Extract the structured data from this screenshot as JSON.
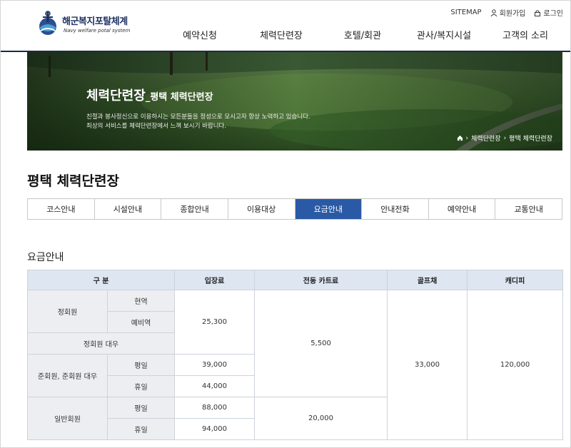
{
  "header": {
    "logo_title": "해군복지포탈체계",
    "logo_sub": "Navy welfare potal system",
    "util": {
      "sitemap": "SITEMAP",
      "join": "회원가입",
      "login": "로그인"
    },
    "gnb": [
      "예약신청",
      "체력단련장",
      "호텔/회관",
      "관사/복지시설",
      "고객의 소리"
    ]
  },
  "hero": {
    "title": "체력단련장",
    "subtitle": "_평택 체력단련장",
    "desc_line1": "친절과 봉사정신으로 이용하시는 모든분들을 정성으로 모시고자 항상 노력하고 있습니다.",
    "desc_line2": "최상의 서비스를 체력단련장에서 느껴 보시기 바랍니다.",
    "breadcrumb": [
      "체력단련장",
      "평택 체력단련장"
    ]
  },
  "page_title": "평택 체력단련장",
  "tabs": [
    {
      "label": "코스안내",
      "active": false
    },
    {
      "label": "시설안내",
      "active": false
    },
    {
      "label": "종합안내",
      "active": false
    },
    {
      "label": "이용대상",
      "active": false
    },
    {
      "label": "요금안내",
      "active": true
    },
    {
      "label": "안내전화",
      "active": false
    },
    {
      "label": "예약안내",
      "active": false
    },
    {
      "label": "교통안내",
      "active": false
    }
  ],
  "section_title": "요금안내",
  "table": {
    "headers": [
      "구 분",
      "입장료",
      "전동 카트료",
      "골프채",
      "캐디피"
    ],
    "groups": {
      "regular": "정회원",
      "regular_proxy": "정회원 대우",
      "associate": "준회원, 준회원 대우",
      "general": "일반회원"
    },
    "sub": {
      "active": "현역",
      "reserve": "예비역",
      "weekday": "평일",
      "holiday": "휴일"
    },
    "fees": {
      "regular_entry": "25,300",
      "associate_weekday": "39,000",
      "associate_holiday": "44,000",
      "general_weekday": "88,000",
      "general_holiday": "94,000",
      "cart_members": "5,500",
      "cart_general": "20,000",
      "clubs": "33,000",
      "caddie": "120,000"
    }
  },
  "colors": {
    "brand_navy": "#1c2f5e",
    "tab_active": "#2a5aa6",
    "table_header": "#dde6f1",
    "table_group": "#eceef1"
  }
}
